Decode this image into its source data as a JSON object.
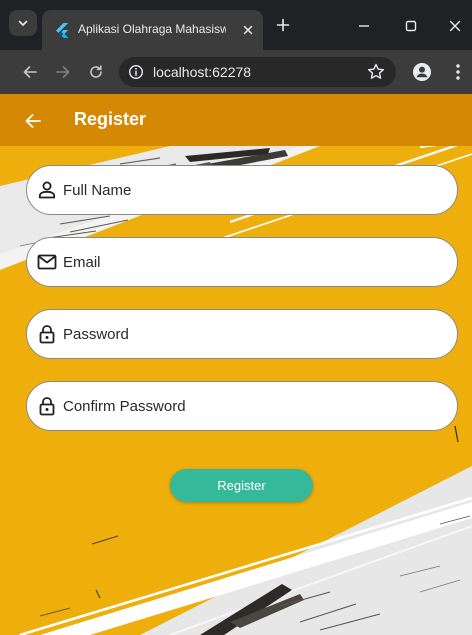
{
  "browser": {
    "tab_title": "Aplikasi Olahraga Mahasiswa",
    "url": "localhost:62278"
  },
  "app": {
    "title": "Register"
  },
  "form": {
    "full_name_placeholder": "Full Name",
    "email_placeholder": "Email",
    "password_placeholder": "Password",
    "confirm_password_placeholder": "Confirm Password",
    "submit_label": "Register"
  },
  "colors": {
    "appbar": "#d48803",
    "background": "#eeae0b",
    "button": "#36b99b",
    "chrome": "#202124"
  },
  "icons": {
    "full_name": "person-icon",
    "email": "mail-icon",
    "password": "lock-icon",
    "confirm_password": "lock-icon",
    "back": "arrow-left-icon"
  }
}
